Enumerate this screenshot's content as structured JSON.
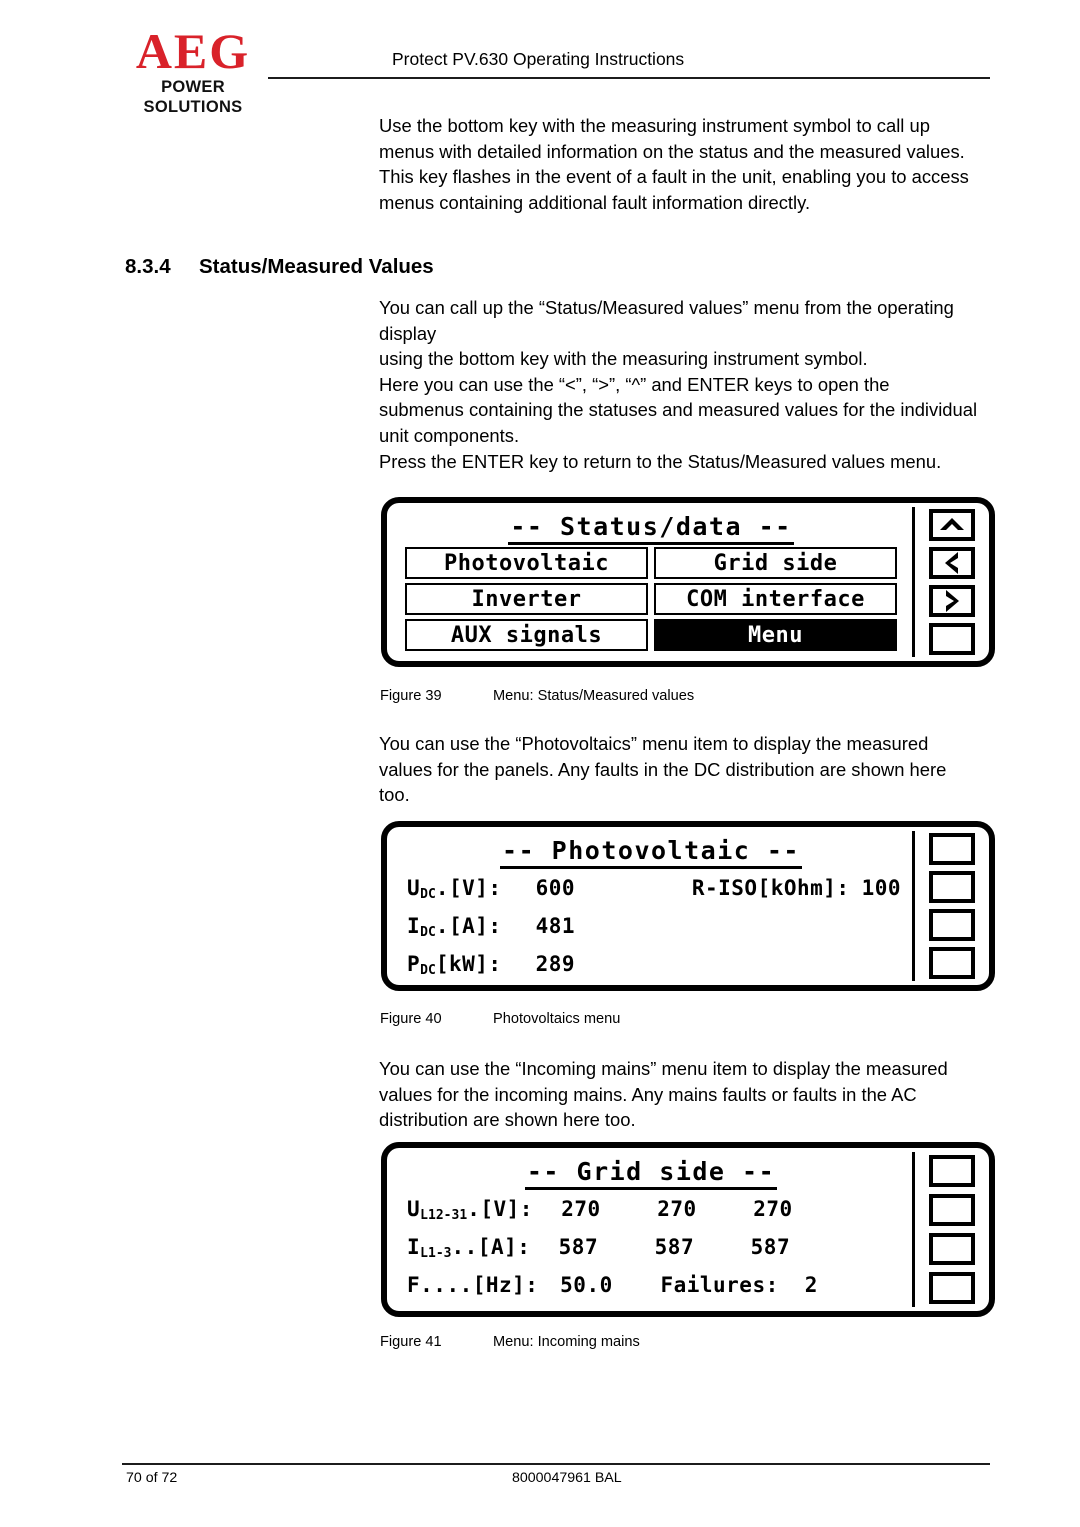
{
  "header": {
    "logo_main": "AEG",
    "logo_sub": "POWER SOLUTIONS",
    "title": "Protect PV.630 Operating Instructions"
  },
  "body": {
    "intro_paragraph": "Use the bottom key with the measuring instrument symbol to call up menus with detailed information on the status and the measured values. This key flashes in the event of a fault in the unit, enabling you to access menus containing additional fault information directly.",
    "section_number": "8.3.4",
    "section_title": "Status/Measured Values",
    "paragraph_a": "You can call up the “Status/Measured values” menu from the operating display\nusing the bottom key with the measuring instrument symbol.\nHere you can use the “<”, “>”, “^” and ENTER keys to open the submenus containing the statuses and measured values for the individual unit components.\nPress the ENTER key to return to the Status/Measured values menu.",
    "paragraph_pv": "You can use the “Photovoltaics” menu item to display the measured values for the panels. Any faults in the DC distribution are shown here too.",
    "paragraph_mains": "You can use the “Incoming mains” menu item to display the measured values for the incoming mains. Any mains faults or faults in the AC distribution are shown here too."
  },
  "figure39": {
    "caption_number": "Figure 39",
    "caption_text": "Menu: Status/Measured values",
    "lcd": {
      "title": "-- Status/data --",
      "items": [
        {
          "label": "Photovoltaic",
          "selected": false
        },
        {
          "label": "Grid side",
          "selected": false
        },
        {
          "label": "Inverter",
          "selected": false
        },
        {
          "label": "COM interface",
          "selected": false
        },
        {
          "label": "AUX signals",
          "selected": false
        },
        {
          "label": "Menu",
          "selected": true
        }
      ],
      "keys": [
        {
          "icon": "chevron-up-icon",
          "glyph": "^"
        },
        {
          "icon": "chevron-left-icon",
          "glyph": "<"
        },
        {
          "icon": "chevron-right-icon",
          "glyph": ">"
        },
        {
          "icon": "blank-key-icon",
          "glyph": ""
        }
      ]
    }
  },
  "figure40": {
    "caption_number": "Figure 40",
    "caption_text": "Photovoltaics menu",
    "lcd": {
      "title": "-- Photovoltaic --",
      "rows": [
        {
          "label_main": "U",
          "label_sub": "DC",
          "label_rest": ".[V]:",
          "value": "600",
          "extra_label": "R-ISO[kOhm]:",
          "extra_value": "100"
        },
        {
          "label_main": "I",
          "label_sub": "DC",
          "label_rest": ".[A]:",
          "value": "481",
          "extra_label": "",
          "extra_value": ""
        },
        {
          "label_main": "P",
          "label_sub": "DC",
          "label_rest": "[kW]:",
          "value": "289",
          "extra_label": "",
          "extra_value": ""
        }
      ],
      "keys": [
        {
          "icon": "blank-key-icon",
          "glyph": ""
        },
        {
          "icon": "blank-key-icon",
          "glyph": ""
        },
        {
          "icon": "blank-key-icon",
          "glyph": ""
        },
        {
          "icon": "blank-key-icon",
          "glyph": ""
        }
      ]
    }
  },
  "figure41": {
    "caption_number": "Figure 41",
    "caption_text": "Menu: Incoming mains",
    "lcd": {
      "title": "-- Grid side --",
      "rows": [
        {
          "label_main": "U",
          "label_sub": "L12-31",
          "label_rest": ".[V]:",
          "values": [
            "270",
            "270",
            "270"
          ],
          "extra_label": "",
          "extra_value": ""
        },
        {
          "label_main": "I",
          "label_sub": "L1-3",
          "label_rest": "..[A]:",
          "values": [
            "587",
            "587",
            "587"
          ],
          "extra_label": "",
          "extra_value": ""
        },
        {
          "label_main": "F",
          "label_sub": "",
          "label_rest": "....[Hz]:",
          "values": [
            "50.0"
          ],
          "extra_label": "Failures:",
          "extra_value": "2"
        }
      ],
      "keys": [
        {
          "icon": "blank-key-icon",
          "glyph": ""
        },
        {
          "icon": "blank-key-icon",
          "glyph": ""
        },
        {
          "icon": "blank-key-icon",
          "glyph": ""
        },
        {
          "icon": "blank-key-icon",
          "glyph": ""
        }
      ]
    }
  },
  "footer": {
    "page": "70 of 72",
    "document_id": "8000047961 BAL"
  },
  "colors": {
    "logo_red": "#d9222a",
    "rule": "#1c1c1c",
    "lcd_border": "#000000",
    "selected_bg": "#000000"
  }
}
